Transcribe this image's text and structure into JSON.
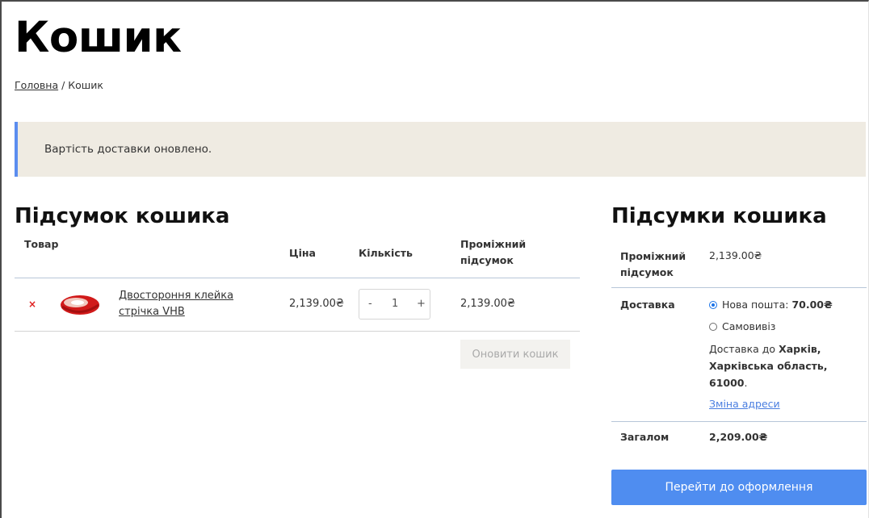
{
  "page": {
    "title": "Кошик"
  },
  "breadcrumb": {
    "home": "Головна",
    "separator": " / ",
    "current": "Кошик"
  },
  "notice": {
    "text": "Вартість доставки оновлено."
  },
  "cart": {
    "heading": "Підсумок кошика",
    "columns": {
      "product": "Товар",
      "price": "Ціна",
      "quantity": "Кількість",
      "subtotal_line1": "Проміжний",
      "subtotal_line2": "підсумок"
    },
    "items": [
      {
        "remove": "×",
        "name_line1": "Двостороння клейка",
        "name_line2": "стрічка VHB",
        "price": "2,139.00₴",
        "qty_minus": "-",
        "qty": "1",
        "qty_plus": "+",
        "subtotal": "2,139.00₴"
      }
    ],
    "update_button": "Оновити кошик"
  },
  "totals": {
    "heading": "Підсумки кошика",
    "subtotal_label_line1": "Проміжний",
    "subtotal_label_line2": "підсумок",
    "subtotal_value": "2,139.00₴",
    "shipping_label": "Доставка",
    "shipping_option1_name": "Нова пошта:",
    "shipping_option1_price": "70.00₴",
    "shipping_option2_name": "Самовивіз",
    "destination_prefix": "Доставка до",
    "destination_city": "Харків,",
    "destination_region": "Харківська область,",
    "destination_zip": "61000",
    "destination_suffix": ".",
    "change_address": "Зміна адреси",
    "total_label": "Загалом",
    "total_value": "2,209.00₴"
  },
  "checkout_button": "Перейти до оформлення",
  "colors": {
    "accent": "#4f8df0",
    "notice_bg": "#efebe2",
    "notice_border": "#5b8def",
    "remove": "#e02020"
  }
}
